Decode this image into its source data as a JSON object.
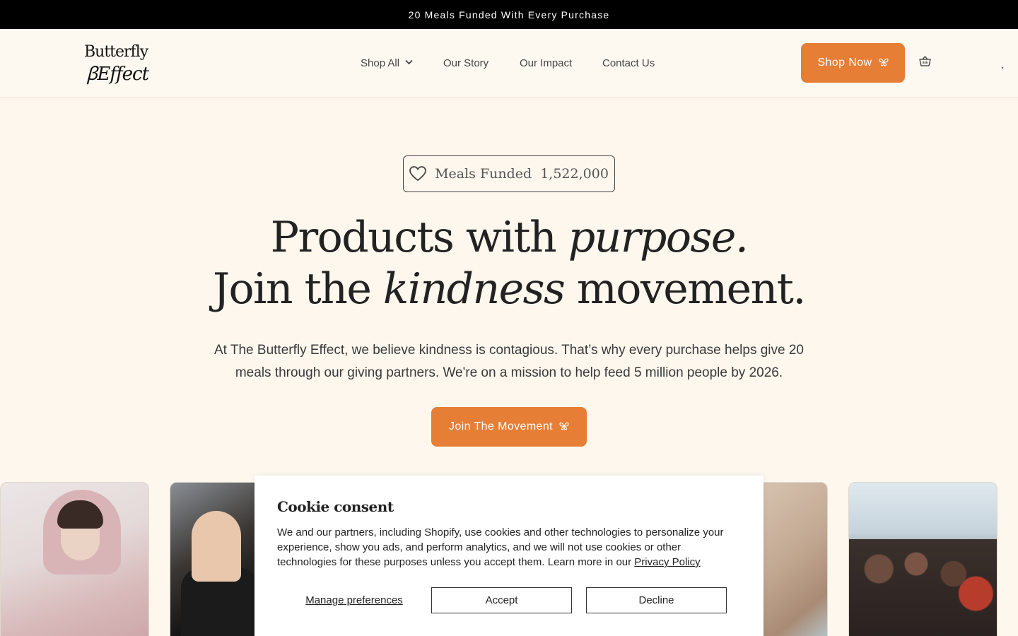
{
  "announcement": "20 Meals Funded With Every Purchase",
  "header": {
    "logo_line1": "Butterfly",
    "logo_line2": "Effect",
    "nav": [
      {
        "label": "Shop All"
      },
      {
        "label": "Our Story"
      },
      {
        "label": "Our Impact"
      },
      {
        "label": "Contact Us"
      }
    ],
    "shop_now": "Shop Now"
  },
  "hero": {
    "meals_label": "Meals Funded",
    "meals_count": "1,522,000",
    "title_line1_a": "Products with ",
    "title_line1_em": "purpose.",
    "title_line2_a": "Join the ",
    "title_line2_em": "kindness",
    "title_line2_b": " movement.",
    "lead": "At The Butterfly Effect, we believe kindness is contagious. That’s why every purchase helps give 20 meals through our giving partners. We're on a mission to help feed 5 million people by 2026.",
    "cta": "Join The Movement"
  },
  "cookie": {
    "title": "Cookie consent",
    "body": "We and our partners, including Shopify, use cookies and other technologies to personalize your experience, show you ads, and perform analytics, and we will not use cookies or other technologies for these purposes unless you accept them. Learn more in our ",
    "privacy_link": "Privacy Policy",
    "manage": "Manage preferences",
    "accept": "Accept",
    "decline": "Decline"
  },
  "colors": {
    "accent": "#e67e36",
    "background": "#fdf7ee",
    "announcement_bg": "#000000"
  },
  "icons": {
    "nav_dropdown": "chevron-down-icon",
    "button": "butterfly-icon",
    "cart": "basket-icon",
    "meals": "heart-icon"
  }
}
